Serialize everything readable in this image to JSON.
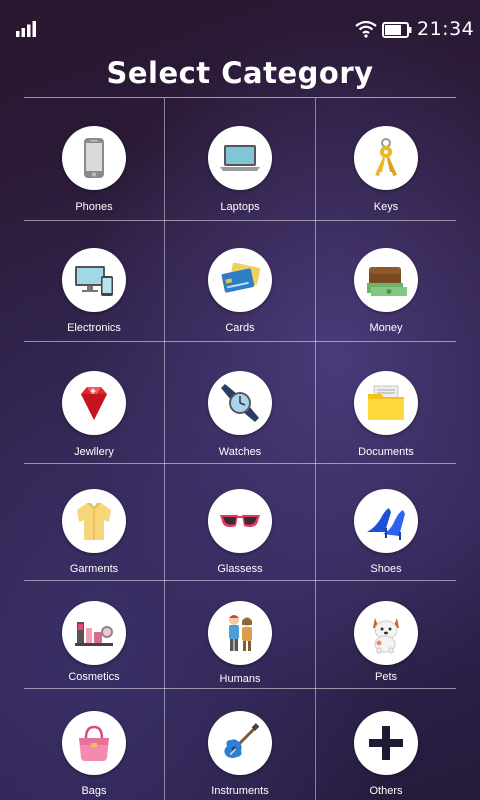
{
  "status_bar": {
    "time": "21:34",
    "icons": [
      "signal-icon",
      "wifi-icon",
      "battery-icon"
    ]
  },
  "header": {
    "title": "Select Category"
  },
  "categories": [
    {
      "label": "Phones",
      "icon": "phone-icon"
    },
    {
      "label": "Laptops",
      "icon": "laptop-icon"
    },
    {
      "label": "Keys",
      "icon": "keys-icon"
    },
    {
      "label": "Electronics",
      "icon": "electronics-icon"
    },
    {
      "label": "Cards",
      "icon": "cards-icon"
    },
    {
      "label": "Money",
      "icon": "money-icon"
    },
    {
      "label": "Jewllery",
      "icon": "gem-icon"
    },
    {
      "label": "Watches",
      "icon": "watch-icon"
    },
    {
      "label": "Documents",
      "icon": "folder-icon"
    },
    {
      "label": "Garments",
      "icon": "shirt-icon"
    },
    {
      "label": "Glassess",
      "icon": "sunglasses-icon"
    },
    {
      "label": "Shoes",
      "icon": "high-heel-icon"
    },
    {
      "label": "Cosmetics",
      "icon": "cosmetics-icon"
    },
    {
      "label": "Humans",
      "icon": "people-icon"
    },
    {
      "label": "Pets",
      "icon": "dog-icon"
    },
    {
      "label": "Bags",
      "icon": "handbag-icon"
    },
    {
      "label": "Instruments",
      "icon": "guitar-icon"
    },
    {
      "label": "Others",
      "icon": "plus-icon"
    }
  ]
}
